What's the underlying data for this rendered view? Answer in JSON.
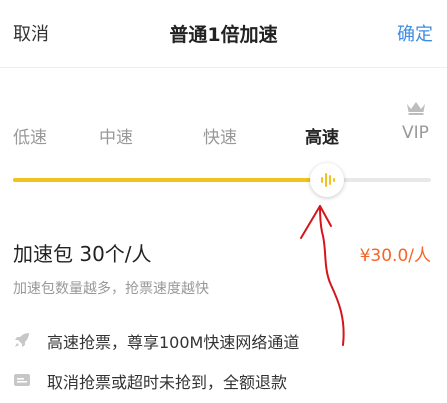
{
  "header": {
    "cancel_label": "取消",
    "title": "普通1倍加速",
    "confirm_label": "确定"
  },
  "levels": [
    {
      "label": "低速"
    },
    {
      "label": "中速"
    },
    {
      "label": "快速"
    },
    {
      "label": "高速",
      "selected": true
    },
    {
      "label": "VIP",
      "icon": "crown-icon"
    }
  ],
  "slider": {
    "value_fraction": 0.75,
    "fill_color": "#f4c21c",
    "track_color": "#e8e8e8",
    "thumb_icon": "sound-wave-icon"
  },
  "package": {
    "label": "加速包 30个/人",
    "price": "¥30.0/人",
    "description": "加速包数量越多，抢票速度越快"
  },
  "features": [
    {
      "icon": "rocket-icon",
      "text": "高速抢票，尊享100M快速网络通道"
    },
    {
      "icon": "refund-icon",
      "text": "取消抢票或超时未抢到，全额退款"
    }
  ],
  "colors": {
    "accent_blue": "#3f8ee0",
    "price_orange": "#f4652a",
    "slider_yellow": "#f4c21c",
    "annotation_red": "#d4161c"
  }
}
